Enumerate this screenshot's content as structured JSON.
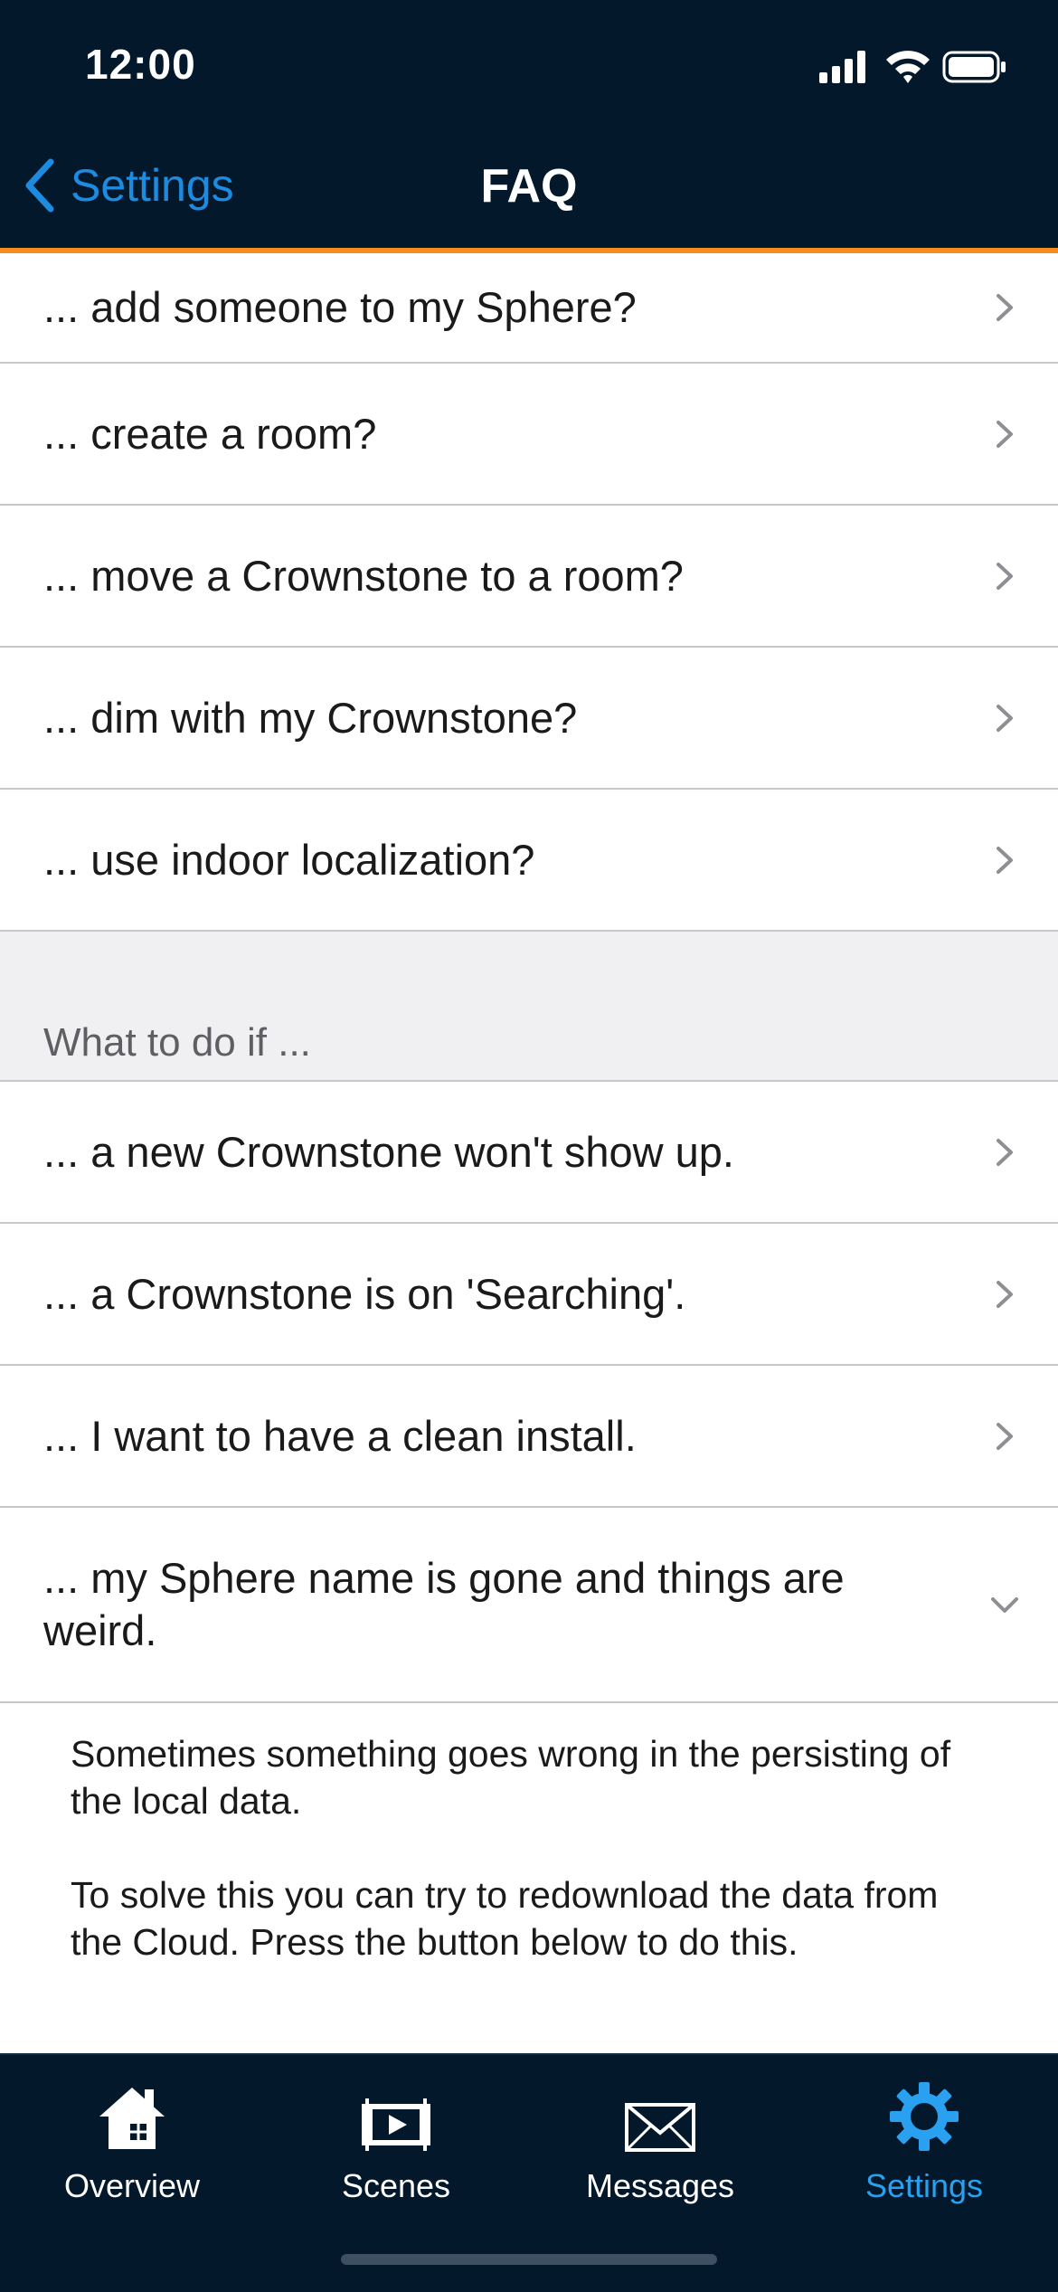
{
  "status_bar": {
    "time": "12:00"
  },
  "nav": {
    "back_label": "Settings",
    "title": "FAQ"
  },
  "how_items": [
    "... add someone to my Sphere?",
    "... create a room?",
    "... move a Crownstone to a room?",
    "... dim with my Crownstone?",
    "... use indoor localization?"
  ],
  "section_if": {
    "header": "What to do if ..."
  },
  "if_items": [
    "... a new Crownstone won't show up.",
    "... a Crownstone is on 'Searching'.",
    "... I want to have a clean install."
  ],
  "expanded_item": {
    "label": "... my Sphere name is gone and things are weird.",
    "answer_p1": "Sometimes something goes wrong in the persisting of the local data.",
    "answer_p2": "To solve this you can try to redownload the data from the Cloud. Press the button below to do this."
  },
  "tabs": [
    {
      "label": "Overview",
      "icon": "house-icon"
    },
    {
      "label": "Scenes",
      "icon": "scenes-icon"
    },
    {
      "label": "Messages",
      "icon": "envelope-icon"
    },
    {
      "label": "Settings",
      "icon": "gear-icon",
      "active": true
    }
  ],
  "colors": {
    "header_bg": "#03192b",
    "accent": "#f68b1e",
    "link": "#1c8be0",
    "tab_active": "#2aa0f0"
  }
}
